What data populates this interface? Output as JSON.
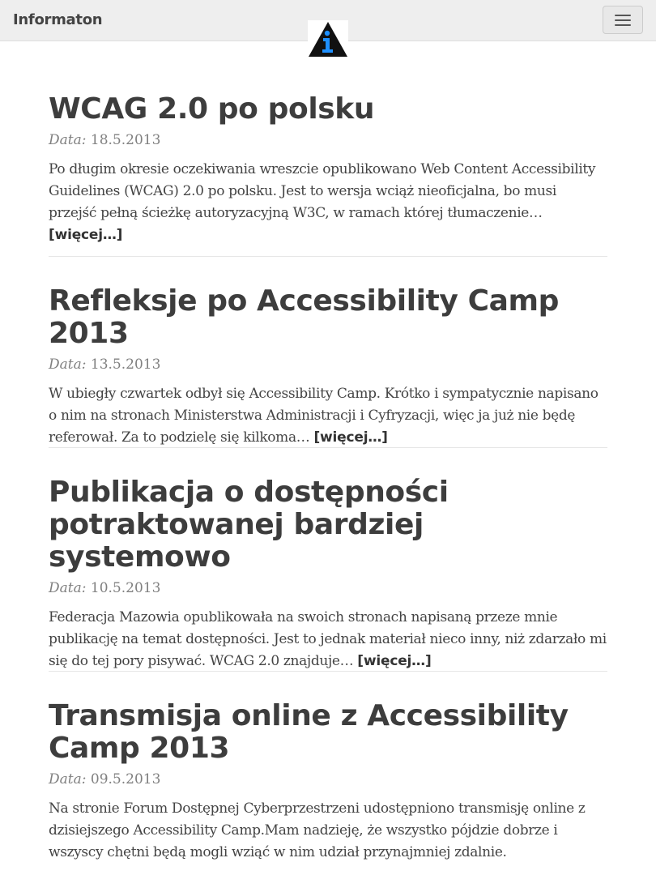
{
  "header": {
    "brand": "Informaton",
    "logo_icon": "information-triangle-logo-icon",
    "menu_icon": "hamburger-menu-icon"
  },
  "colors": {
    "navbar_bg": "#eeeeee",
    "logo_accent": "#1e90ff",
    "title_text": "#3d3d3d",
    "meta_text": "#808080"
  },
  "posts": [
    {
      "title": "WCAG 2.0 po polsku",
      "date_label": "Data:",
      "date": "18.5.2013",
      "excerpt": "Po długim okresie oczekiwania wreszcie opublikowano Web Content Accessibility Guidelines (WCAG) 2.0 po polsku. Jest to wersja wciąż nieoficjalna, bo musi przejść pełną ścieżkę autoryzacyjną W3C, w ramach której tłumaczenie…",
      "more": "[więcej…]"
    },
    {
      "title": "Refleksje po Accessibility Camp 2013",
      "date_label": "Data:",
      "date": "13.5.2013",
      "excerpt": "W ubiegły czwartek odbył się Accessibility Camp. Krótko i sympatycznie napisano o nim na stronach Ministerstwa Administracji i Cyfryzacji, więc ja już nie będę referował. Za to podzielę się kilkoma…",
      "more": "[więcej…]"
    },
    {
      "title": "Publikacja o dostępności potraktowanej bardziej systemowo",
      "date_label": "Data:",
      "date": "10.5.2013",
      "excerpt": "Federacja Mazowia opublikowała na swoich stronach napisaną przeze mnie publikację na temat dostępności. Jest to jednak materiał nieco inny, niż zdarzało mi się do tej pory pisywać. WCAG 2.0 znajduje…",
      "more": "[więcej…]"
    },
    {
      "title": "Transmisja online z Accessibility Camp 2013",
      "date_label": "Data:",
      "date": "09.5.2013",
      "excerpt": "Na stronie Forum Dostępnej Cyberprzestrzeni udostępniono transmisję online z dzisiejszego Accessibility Camp.Mam nadzieję, że wszystko pójdzie dobrze i wszyscy chętni będą mogli wziąć w nim udział przynajmniej zdalnie.",
      "more": ""
    }
  ]
}
